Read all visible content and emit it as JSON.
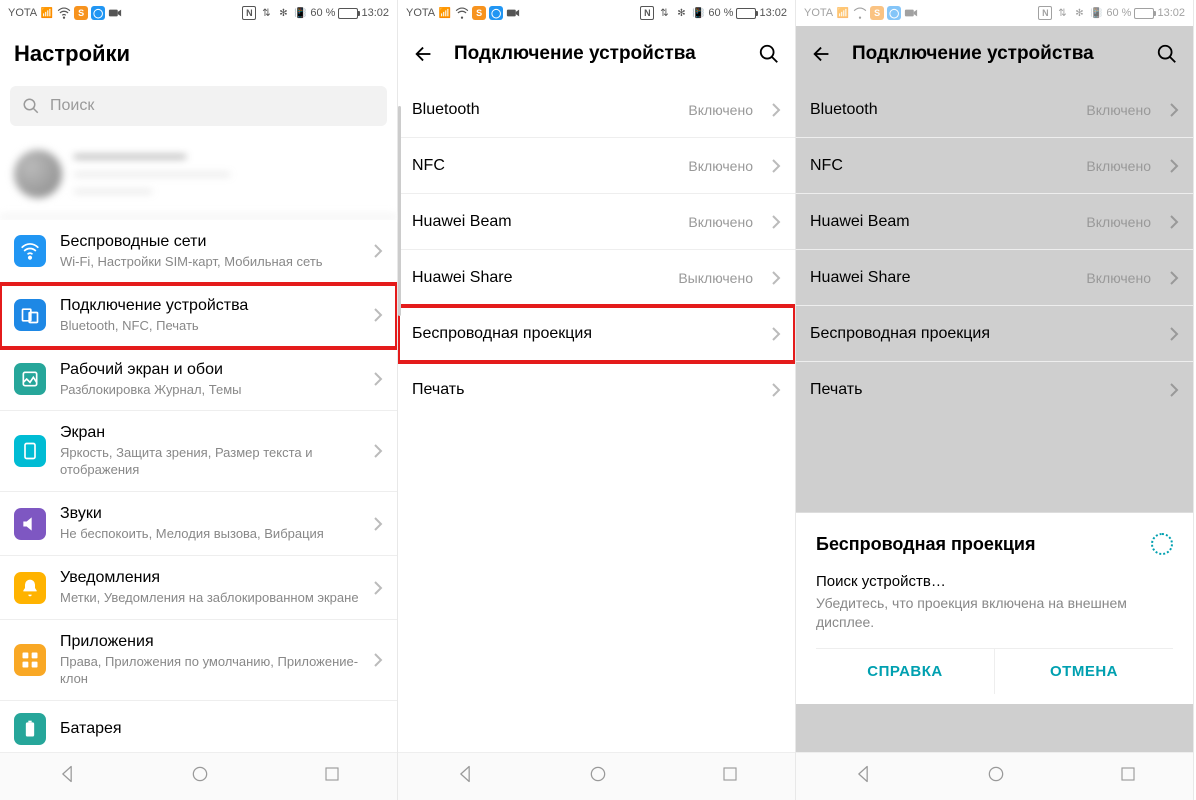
{
  "statusBar": {
    "carrier": "YOTA",
    "batteryPct": "60 %",
    "time": "13:02",
    "iconN": "N",
    "iconBt": "✻"
  },
  "screen1": {
    "title": "Настройки",
    "searchPlaceholder": "Поиск",
    "items": [
      {
        "title": "Беспроводные сети",
        "sub": "Wi-Fi, Настройки SIM-карт, Мобильная сеть"
      },
      {
        "title": "Подключение устройства",
        "sub": "Bluetooth, NFC, Печать"
      },
      {
        "title": "Рабочий экран и обои",
        "sub": "Разблокировка Журнал, Темы"
      },
      {
        "title": "Экран",
        "sub": "Яркость, Защита зрения, Размер текста и отображения"
      },
      {
        "title": "Звуки",
        "sub": "Не беспокоить, Мелодия вызова, Вибрация"
      },
      {
        "title": "Уведомления",
        "sub": "Метки, Уведомления на заблокированном экране"
      },
      {
        "title": "Приложения",
        "sub": "Права, Приложения по умолчанию, Приложение-клон"
      },
      {
        "title": "Батарея",
        "sub": ""
      }
    ]
  },
  "screen2": {
    "title": "Подключение устройства",
    "rows": [
      {
        "label": "Bluetooth",
        "status": "Включено"
      },
      {
        "label": "NFC",
        "status": "Включено"
      },
      {
        "label": "Huawei Beam",
        "status": "Включено"
      },
      {
        "label": "Huawei Share",
        "status": "Выключено"
      },
      {
        "label": "Беспроводная проекция",
        "status": ""
      },
      {
        "label": "Печать",
        "status": ""
      }
    ]
  },
  "screen3": {
    "title": "Подключение устройства",
    "rows": [
      {
        "label": "Bluetooth",
        "status": "Включено"
      },
      {
        "label": "NFC",
        "status": "Включено"
      },
      {
        "label": "Huawei Beam",
        "status": "Включено"
      },
      {
        "label": "Huawei Share",
        "status": "Включено"
      },
      {
        "label": "Беспроводная проекция",
        "status": ""
      },
      {
        "label": "Печать",
        "status": ""
      }
    ],
    "sheet": {
      "title": "Беспроводная проекция",
      "status": "Поиск устройств…",
      "hint": "Убедитесь, что проекция включена на внешнем дисплее.",
      "help": "СПРАВКА",
      "cancel": "ОТМЕНА"
    }
  }
}
